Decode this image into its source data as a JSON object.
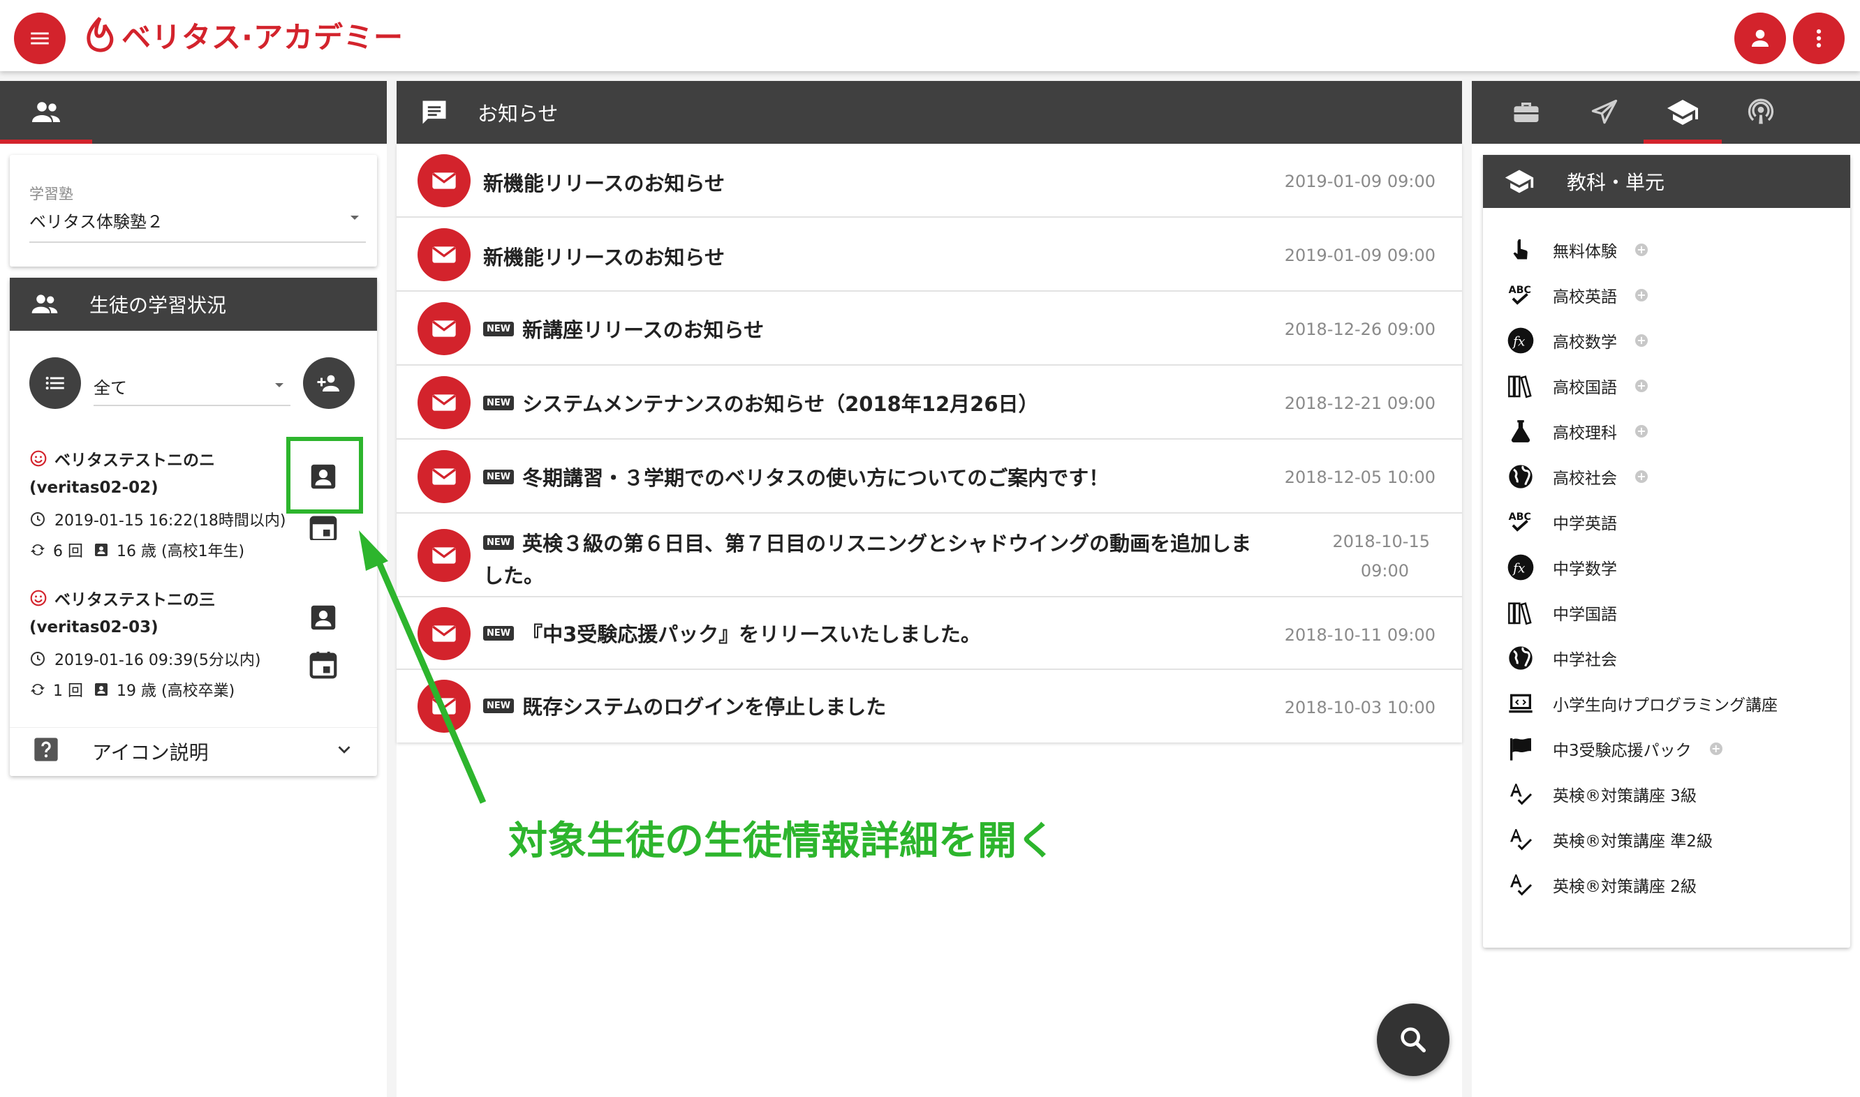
{
  "header": {
    "logo_text": "ベリタス·アカデミー",
    "menu_icon": "menu-icon",
    "account_icon": "account-icon",
    "more_icon": "more-vert-icon"
  },
  "colors": {
    "brand_red": "#d3232c",
    "dark_bar": "#404040",
    "annotation_green": "#2db52d"
  },
  "left": {
    "tab_icon": "people-icon",
    "school_select": {
      "label": "学習塾",
      "value": "ベリタス体験塾２"
    },
    "section_title": "生徒の学習状況",
    "filter_select": {
      "value": "全て"
    },
    "students": [
      {
        "name": "ベリタステストニのニ",
        "id": "(veritas02-02)",
        "last_login": "2019-01-15 16:22(18時間以内)",
        "count": "6 回",
        "age": "16 歳 (高校1年生)"
      },
      {
        "name": "ベリタステストニの三",
        "id": "(veritas02-03)",
        "last_login": "2019-01-16 09:39(5分以内)",
        "count": "1 回",
        "age": "19 歳 (高校卒業)"
      }
    ],
    "icon_help": "アイコン説明"
  },
  "main": {
    "title": "お知らせ",
    "notices": [
      {
        "title": "新機能リリースのお知らせ",
        "date": "2019-01-09 09:00",
        "new": false
      },
      {
        "title": "新機能リリースのお知らせ",
        "date": "2019-01-09 09:00",
        "new": false
      },
      {
        "title": "新講座リリースのお知らせ",
        "date": "2018-12-26 09:00",
        "new": true
      },
      {
        "title": "システムメンテナンスのお知らせ（2018年12月26日）",
        "date": "2018-12-21 09:00",
        "new": true
      },
      {
        "title": "冬期講習・３学期でのベリタスの使い方についてのご案内です！",
        "date": "2018-12-05 10:00",
        "new": true
      },
      {
        "title_line1": "英検３級の第６日目、第７日目のリスニングとシャドウイングの動画を追加しま",
        "title_line2": "した。",
        "date_line1": "2018-10-15",
        "date_line2": "09:00",
        "new": true
      },
      {
        "title": "『中3受験応援パック』をリリースいたしました。",
        "date": "2018-10-11 09:00",
        "new": true
      },
      {
        "title": "既存システムのログインを停止しました",
        "date": "2018-10-03 10:00",
        "new": true
      }
    ],
    "new_badge": "NEW"
  },
  "right": {
    "section_title": "教科・単元",
    "subjects": [
      {
        "label": "無料体験",
        "plus": true
      },
      {
        "label": "高校英語",
        "plus": true
      },
      {
        "label": "高校数学",
        "plus": true
      },
      {
        "label": "高校国語",
        "plus": true
      },
      {
        "label": "高校理科",
        "plus": true
      },
      {
        "label": "高校社会",
        "plus": true
      },
      {
        "label": "中学英語",
        "plus": false
      },
      {
        "label": "中学数学",
        "plus": false
      },
      {
        "label": "中学国語",
        "plus": false
      },
      {
        "label": "中学社会",
        "plus": false
      },
      {
        "label": "小学生向けプログラミング講座",
        "plus": false
      },
      {
        "label": "中3受験応援パック",
        "plus": true
      },
      {
        "label": "英検®対策講座 3級",
        "plus": false
      },
      {
        "label": "英検®対策講座 準2級",
        "plus": false
      },
      {
        "label": "英検®対策講座 2級",
        "plus": false
      }
    ]
  },
  "annotation": {
    "text": "対象生徒の生徒情報詳細を開く"
  }
}
